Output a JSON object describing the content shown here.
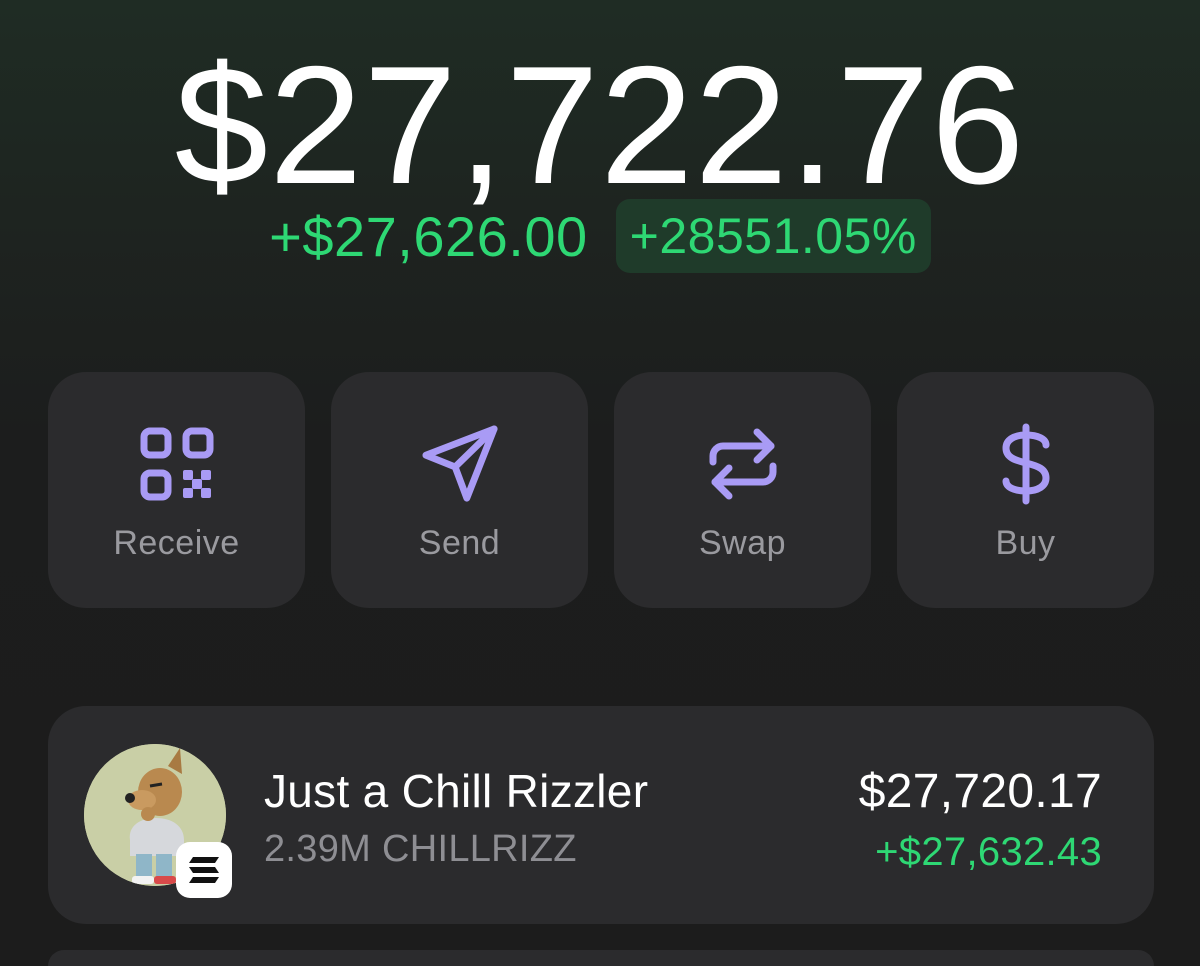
{
  "balance": {
    "total": "$27,722.76",
    "change_abs": "+$27,626.00",
    "change_pct": "+28551.05%"
  },
  "actions": [
    {
      "label": "Receive",
      "icon": "qr-code-icon"
    },
    {
      "label": "Send",
      "icon": "send-icon"
    },
    {
      "label": "Swap",
      "icon": "swap-icon"
    },
    {
      "label": "Buy",
      "icon": "dollar-icon"
    }
  ],
  "tokens": [
    {
      "name": "Just a Chill Rizzler",
      "amount": "2.39M CHILLRIZZ",
      "value": "$27,720.17",
      "change": "+$27,632.43",
      "chain_icon": "solana-icon",
      "avatar_icon": "chill-dog-avatar"
    }
  ],
  "colors": {
    "positive": "#2ed874",
    "accent": "#a99bf5",
    "card": "#2b2b2d",
    "muted_text": "#9a9a9f"
  }
}
